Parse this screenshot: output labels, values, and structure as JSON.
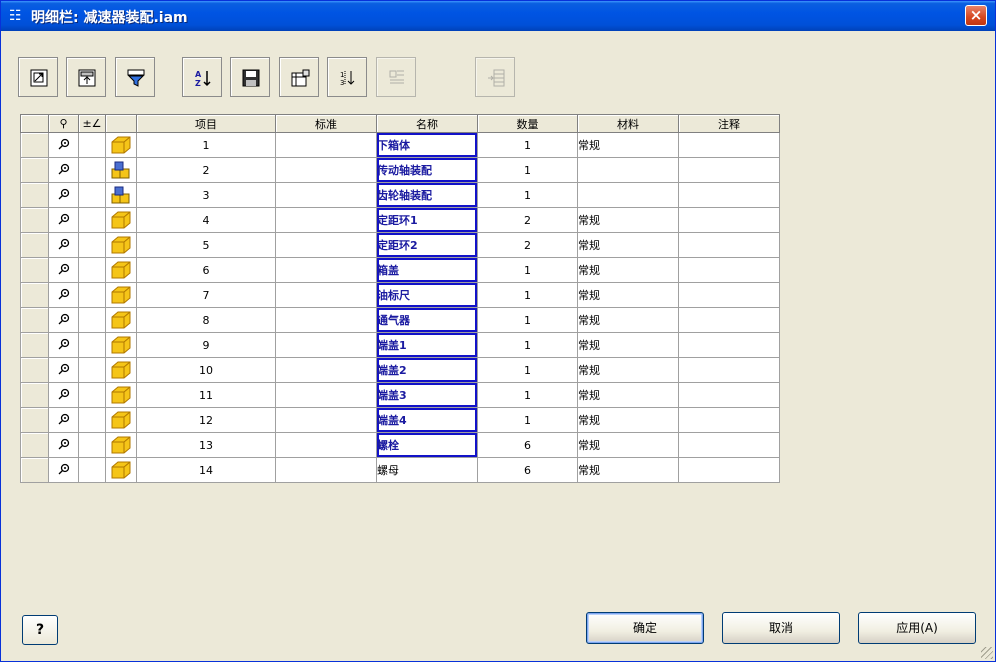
{
  "window": {
    "title": "明细栏: 减速器装配.iam",
    "close_label": "×"
  },
  "toolbar": {
    "buttons": [
      "view-options",
      "filter-settings",
      "filter",
      "sort",
      "export",
      "table-layout",
      "renumber",
      "compare",
      "merge"
    ]
  },
  "table": {
    "headers": {
      "find_col": "⚲",
      "tag_col": "±∠",
      "icon_col": "",
      "item": "项目",
      "standard": "标准",
      "name": "名称",
      "qty": "数量",
      "material": "材料",
      "note": "注释"
    },
    "rows": [
      {
        "item": "1",
        "standard": "",
        "name": "下箱体",
        "qty": "1",
        "material": "常规",
        "note": "",
        "type": "part",
        "boxed": true
      },
      {
        "item": "2",
        "standard": "",
        "name": "传动轴装配",
        "qty": "1",
        "material": "",
        "note": "",
        "type": "assembly",
        "boxed": true
      },
      {
        "item": "3",
        "standard": "",
        "name": "齿轮轴装配",
        "qty": "1",
        "material": "",
        "note": "",
        "type": "assembly",
        "boxed": true
      },
      {
        "item": "4",
        "standard": "",
        "name": "定距环1",
        "qty": "2",
        "material": "常规",
        "note": "",
        "type": "part",
        "boxed": true
      },
      {
        "item": "5",
        "standard": "",
        "name": "定距环2",
        "qty": "2",
        "material": "常规",
        "note": "",
        "type": "part",
        "boxed": true
      },
      {
        "item": "6",
        "standard": "",
        "name": "箱盖",
        "qty": "1",
        "material": "常规",
        "note": "",
        "type": "part",
        "boxed": true
      },
      {
        "item": "7",
        "standard": "",
        "name": "油标尺",
        "qty": "1",
        "material": "常规",
        "note": "",
        "type": "part",
        "boxed": true
      },
      {
        "item": "8",
        "standard": "",
        "name": "通气器",
        "qty": "1",
        "material": "常规",
        "note": "",
        "type": "part",
        "boxed": true
      },
      {
        "item": "9",
        "standard": "",
        "name": "端盖1",
        "qty": "1",
        "material": "常规",
        "note": "",
        "type": "part",
        "boxed": true
      },
      {
        "item": "10",
        "standard": "",
        "name": "端盖2",
        "qty": "1",
        "material": "常规",
        "note": "",
        "type": "part",
        "boxed": true
      },
      {
        "item": "11",
        "standard": "",
        "name": "端盖3",
        "qty": "1",
        "material": "常规",
        "note": "",
        "type": "part",
        "boxed": true
      },
      {
        "item": "12",
        "standard": "",
        "name": "端盖4",
        "qty": "1",
        "material": "常规",
        "note": "",
        "type": "part",
        "boxed": true
      },
      {
        "item": "13",
        "standard": "",
        "name": "螺栓",
        "qty": "6",
        "material": "常规",
        "note": "",
        "type": "part",
        "boxed": true
      },
      {
        "item": "14",
        "standard": "",
        "name": "螺母",
        "qty": "6",
        "material": "常规",
        "note": "",
        "type": "part",
        "boxed": false
      }
    ]
  },
  "footer": {
    "help_label": "?",
    "ok_label": "确定",
    "cancel_label": "取消",
    "apply_label": "应用(A)"
  },
  "colors": {
    "title_bar": "#0054e3",
    "name_text": "#1a1aa0",
    "name_box": "#1212c8",
    "part_icon": "#f5c518"
  }
}
